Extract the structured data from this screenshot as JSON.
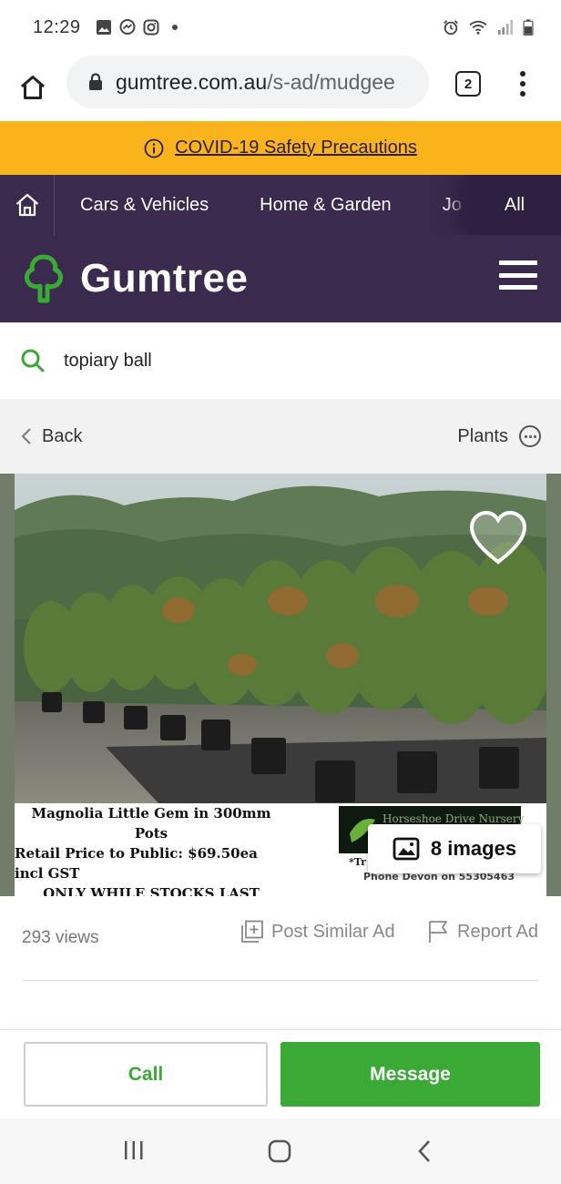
{
  "status_bar": {
    "time": "12:29",
    "left_icons": [
      "gallery-icon",
      "messenger-icon",
      "instagram-icon",
      "dot-icon"
    ],
    "right_icons": [
      "alarm-icon",
      "wifi-icon",
      "signal-icon",
      "battery-icon"
    ]
  },
  "browser": {
    "url_domain": "gumtree.com.au",
    "url_path": "/s-ad/mudgee",
    "tab_count": "2"
  },
  "banner": {
    "text": "COVID-19 Safety Precautions",
    "color": "#fbb31b"
  },
  "category_nav": {
    "items": [
      "Cars & Vehicles",
      "Home & Garden",
      "Jo"
    ],
    "all_label": "All"
  },
  "header": {
    "brand": "Gumtree",
    "brand_color": "#3a2a4d",
    "logo_color": "#3aa935"
  },
  "search": {
    "query": "topiary ball"
  },
  "nav_row": {
    "back_label": "Back",
    "category": "Plants"
  },
  "listing_image": {
    "caption_lines": [
      "Magnolia Little Gem in 300mm Pots",
      "Retail Price to Public: $69.50ea incl GST",
      "ONLY WHILE STOCKS LAST"
    ],
    "nursery_name": "Horseshoe Drive Nursery",
    "nursery_fragment": "*Tr",
    "phone_line": "Phone Devon on 55305463",
    "images_count_label": "8 images"
  },
  "stats": {
    "views": "293 views",
    "post_similar_label": "Post Similar Ad",
    "report_label": "Report Ad"
  },
  "actions": {
    "call_label": "Call",
    "message_label": "Message",
    "accent_color": "#3aa935"
  }
}
